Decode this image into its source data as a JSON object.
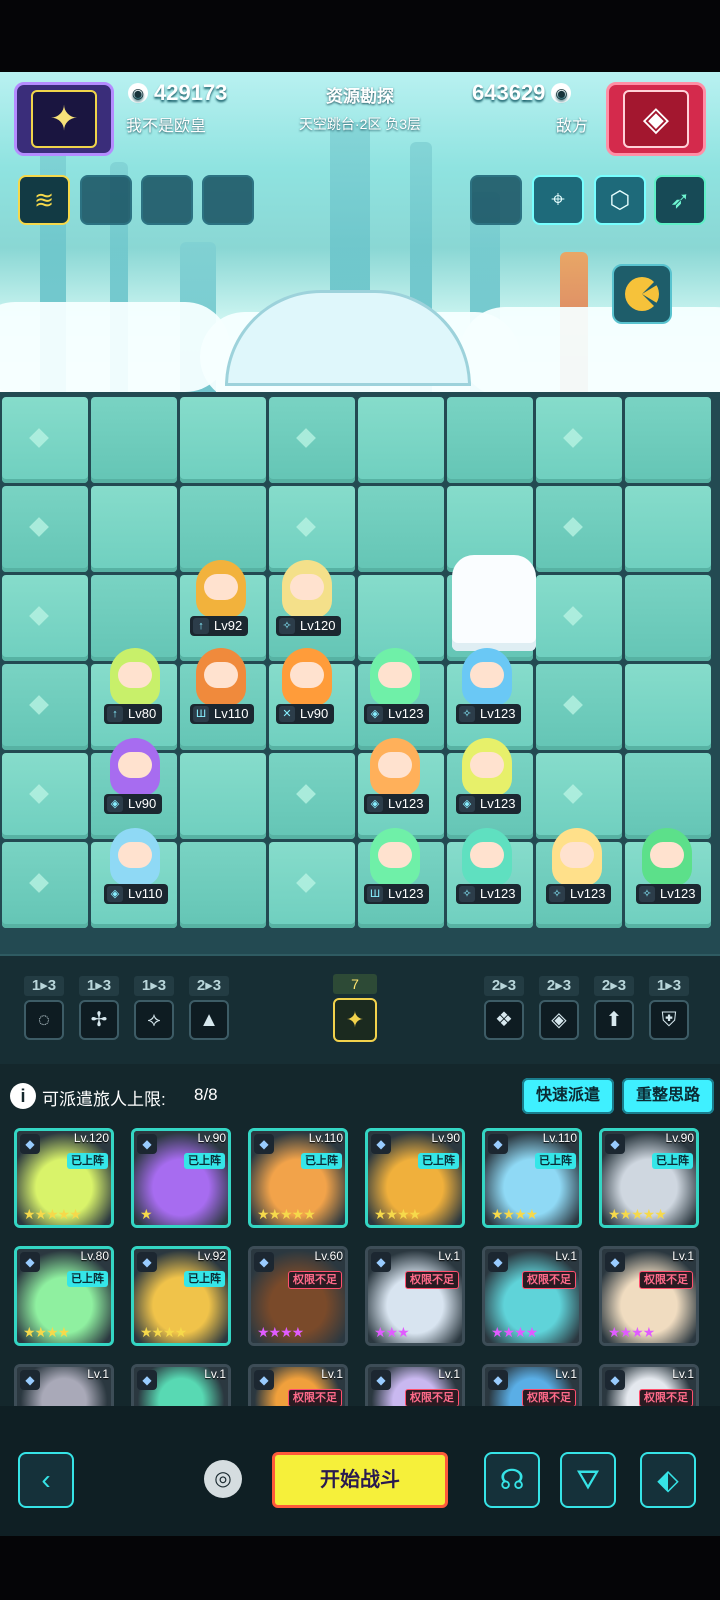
{
  "header": {
    "left_power": "429173",
    "left_name": "我不是欧皇",
    "center_title": "资源勘探",
    "center_sub": "天空跳台·2区  负3层",
    "right_power": "643629",
    "right_name": "敌方",
    "left_icon": "sparkle-star-icon",
    "right_icon": "target-diamond-icon"
  },
  "board_units": [
    {
      "id": "u1",
      "lv": "Lv92",
      "cls": "↑"
    },
    {
      "id": "u2",
      "lv": "Lv120",
      "cls": "✧"
    },
    {
      "id": "u3",
      "lv": "Lv80",
      "cls": "↑"
    },
    {
      "id": "u4",
      "lv": "Lv110",
      "cls": "Ш"
    },
    {
      "id": "u5",
      "lv": "Lv90",
      "cls": "✕"
    },
    {
      "id": "u6",
      "lv": "Lv123",
      "cls": "◈"
    },
    {
      "id": "u7",
      "lv": "Lv123",
      "cls": "✧"
    },
    {
      "id": "u8",
      "lv": "Lv90",
      "cls": "◈"
    },
    {
      "id": "u9",
      "lv": "Lv123",
      "cls": "◈"
    },
    {
      "id": "u10",
      "lv": "Lv123",
      "cls": "◈"
    },
    {
      "id": "u11",
      "lv": "Lv110",
      "cls": "◈"
    },
    {
      "id": "u12",
      "lv": "Lv123",
      "cls": "Ш"
    },
    {
      "id": "u13",
      "lv": "Lv123",
      "cls": "✧"
    },
    {
      "id": "u14",
      "lv": "Lv123",
      "cls": "✧"
    },
    {
      "id": "u15",
      "lv": "Lv123",
      "cls": "✧"
    }
  ],
  "synergies_left": [
    {
      "count": "1▸3",
      "icon": "swirl-icon"
    },
    {
      "count": "1▸3",
      "icon": "shuriken-icon"
    },
    {
      "count": "1▸3",
      "icon": "arrow-crest-icon"
    },
    {
      "count": "2▸3",
      "icon": "mountain-icon"
    }
  ],
  "synergy_center": {
    "count": "7",
    "icon": "sparkle-star-icon"
  },
  "synergies_right": [
    {
      "count": "2▸3",
      "icon": "arrows-diamond-icon"
    },
    {
      "count": "2▸3",
      "icon": "layered-diamond-icon"
    },
    {
      "count": "2▸3",
      "icon": "up-arrow-icon"
    },
    {
      "count": "1▸3",
      "icon": "shield-bars-icon"
    }
  ],
  "dispatch": {
    "limit_label": "可派遣旅人上限:",
    "limit_value": "8/8",
    "quick_btn": "快速派遣",
    "reset_btn": "重整思路"
  },
  "cards": [
    {
      "lv": "Lv.120",
      "status": "已上阵",
      "on": true,
      "stars": "★★★★★",
      "color": "#d9f36a"
    },
    {
      "lv": "Lv.90",
      "status": "已上阵",
      "on": true,
      "stars": "★",
      "color": "#a76cf0"
    },
    {
      "lv": "Lv.110",
      "status": "已上阵",
      "on": true,
      "stars": "★★★★★",
      "color": "#f2a34a"
    },
    {
      "lv": "Lv.90",
      "status": "已上阵",
      "on": true,
      "stars": "★★★★",
      "color": "#f0b03c"
    },
    {
      "lv": "Lv.110",
      "status": "已上阵",
      "on": true,
      "stars": "★★★★",
      "color": "#8fd9f5"
    },
    {
      "lv": "Lv.90",
      "status": "已上阵",
      "on": true,
      "stars": "★★★★★",
      "color": "#cfd7e0"
    },
    {
      "lv": "Lv.80",
      "status": "已上阵",
      "on": true,
      "stars": "★★★★",
      "color": "#8ff0a0"
    },
    {
      "lv": "Lv.92",
      "status": "已上阵",
      "on": true,
      "stars": "★★★★",
      "color": "#f0c34a"
    },
    {
      "lv": "Lv.60",
      "status": "权限不足",
      "on": false,
      "stars": "★★★★",
      "color": "#7a4a2a"
    },
    {
      "lv": "Lv.1",
      "status": "权限不足",
      "on": false,
      "stars": "★★★",
      "color": "#d8e4f0"
    },
    {
      "lv": "Lv.1",
      "status": "权限不足",
      "on": false,
      "stars": "★★★★",
      "color": "#5fd3d9"
    },
    {
      "lv": "Lv.1",
      "status": "权限不足",
      "on": false,
      "stars": "★★★★",
      "color": "#f0dcc0"
    },
    {
      "lv": "Lv.1",
      "status": "",
      "on": false,
      "stars": "",
      "color": "#a9a9b8"
    },
    {
      "lv": "Lv.1",
      "status": "",
      "on": false,
      "stars": "",
      "color": "#58d9b3"
    },
    {
      "lv": "Lv.1",
      "status": "权限不足",
      "on": false,
      "stars": "",
      "color": "#f0a03c"
    },
    {
      "lv": "Lv.1",
      "status": "权限不足",
      "on": false,
      "stars": "",
      "color": "#c9b8f0"
    },
    {
      "lv": "Lv.1",
      "status": "权限不足",
      "on": false,
      "stars": "",
      "color": "#5aaee6"
    },
    {
      "lv": "Lv.1",
      "status": "权限不足",
      "on": false,
      "stars": "",
      "color": "#e4e8ee"
    }
  ],
  "bottom": {
    "start_label": "开始战斗",
    "back_icon": "chevron-left-icon",
    "camera_icon": "camera-icon",
    "brain_icon": "brain-head-icon",
    "filter_icon": "filter-icon",
    "tag_icon": "tag-icon"
  }
}
